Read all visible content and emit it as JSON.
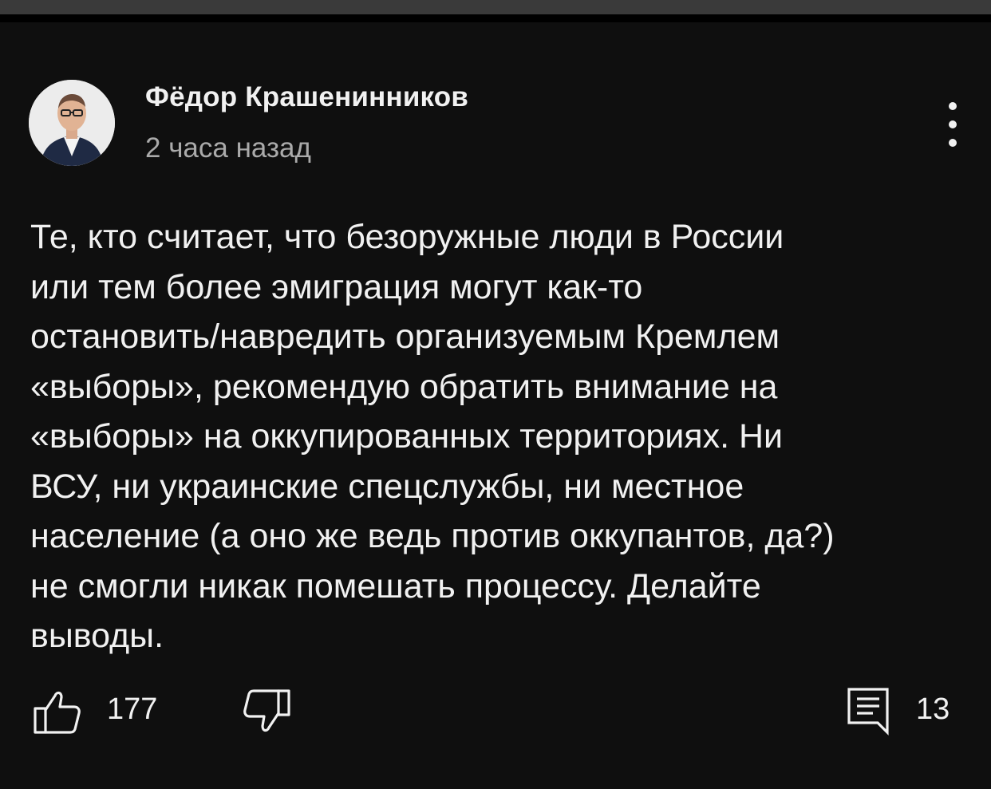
{
  "comment": {
    "author": "Фёдор Крашенинников",
    "time": "2 часа назад",
    "text": "Те, кто считает, что безоружные люди в России\nили тем более эмиграция могут как-то\nостановить/навредить организуемым Кремлем\n«выборы», рекомендую обратить внимание на\n«выборы» на оккупированных территориях. Ни\nВСУ, ни украинские спецслужбы, ни местное\nнаселение (а оно же ведь против оккупантов, да?)\nне смогли никак помешать процессу. Делайте\nвыводы."
  },
  "actions": {
    "like_icon": "thumbs-up-icon",
    "likes": "177",
    "dislike_icon": "thumbs-down-icon",
    "reply_icon": "comment-icon",
    "replies": "13",
    "menu_icon": "more-vertical-icon"
  },
  "colors": {
    "background": "#0f0f0f",
    "text": "#f1f1f1",
    "secondary_text": "#aaaaaa"
  }
}
